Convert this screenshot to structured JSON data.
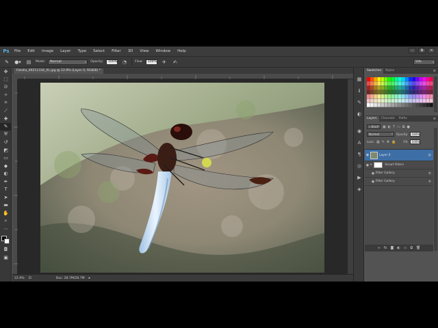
{
  "app": {
    "logo": "Ps"
  },
  "menu": [
    "File",
    "Edit",
    "Image",
    "Layer",
    "Type",
    "Select",
    "Filter",
    "3D",
    "View",
    "Window",
    "Help"
  ],
  "window_controls": {
    "minimize": "–",
    "restore": "⧉",
    "close": "✕"
  },
  "options_bar": {
    "mode_label": "Mode:",
    "mode_value": "Normal",
    "opacity_label": "Opacity:",
    "opacity_value": "100%",
    "flow_label": "Flow:",
    "flow_value": "100%",
    "workspace": "Vdo"
  },
  "document": {
    "tab_title": "Fotolia_49211334_XL.jpg @ 22.9% (Layer 0, RGB/8) *",
    "zoom": "22.9%",
    "doc_info": "Doc: 28.7M/28.7M"
  },
  "swatches": {
    "tabs": [
      "Swatches",
      "Styles"
    ]
  },
  "layers": {
    "tabs": [
      "Layers",
      "Channels",
      "Paths"
    ],
    "filter_kind": "Kind",
    "blend_mode": "Normal",
    "opacity_label": "Opacity:",
    "opacity_value": "100%",
    "lock_label": "Lock:",
    "fill_label": "Fill:",
    "fill_value": "100%",
    "items": [
      {
        "name": "Layer 0"
      },
      {
        "name": "Smart Filters"
      },
      {
        "name": "Filter Gallery"
      },
      {
        "name": "Filter Gallery"
      }
    ]
  },
  "colors": {
    "accent": "#3e6ea6",
    "ps_blue": "#5ab0e6",
    "foreground": "#000000",
    "background": "#ffffff"
  }
}
